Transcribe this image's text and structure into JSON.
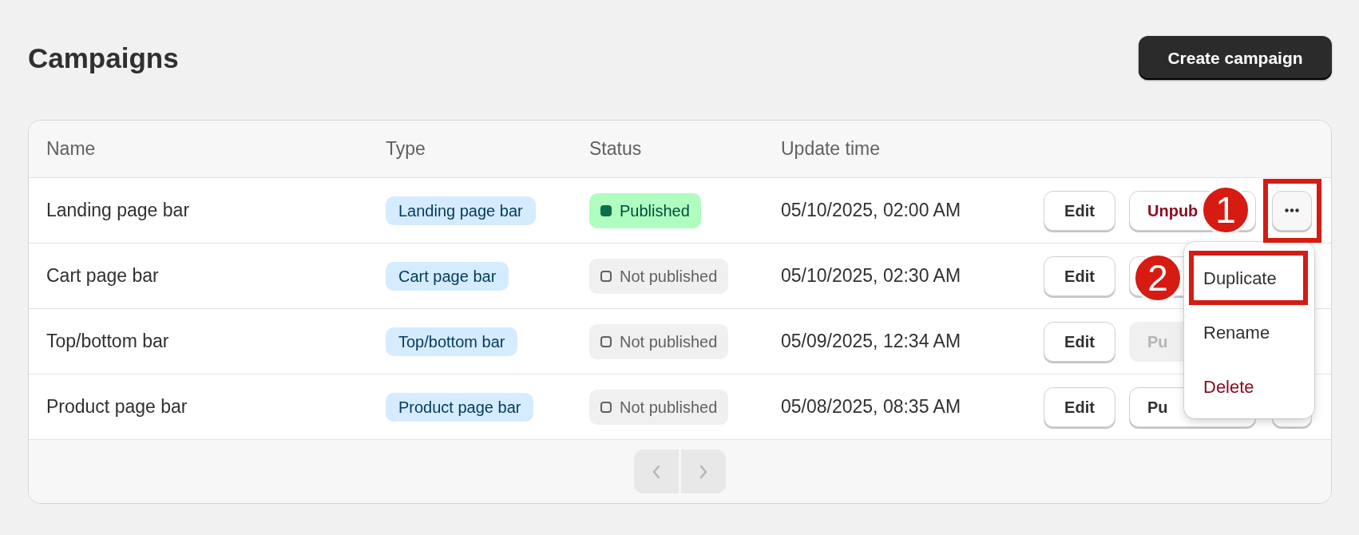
{
  "page": {
    "title": "Campaigns",
    "primary_action": "Create campaign"
  },
  "table": {
    "columns": [
      "Name",
      "Type",
      "Status",
      "Update time"
    ],
    "rows": [
      {
        "name": "Landing page bar",
        "type": "Landing page bar",
        "status": {
          "label": "Published",
          "kind": "published"
        },
        "updated": "05/10/2025, 02:00 AM",
        "edit": "Edit",
        "toggle": {
          "label": "Unpub",
          "kind": "danger",
          "disabled": false
        },
        "more_button": true,
        "menu_open": true
      },
      {
        "name": "Cart page bar",
        "type": "Cart page bar",
        "status": {
          "label": "Not published",
          "kind": "draft"
        },
        "updated": "05/10/2025, 02:30 AM",
        "edit": "Edit",
        "toggle": {
          "kind": "plain",
          "disabled": false
        }
      },
      {
        "name": "Top/bottom bar",
        "type": "Top/bottom bar",
        "status": {
          "label": "Not published",
          "kind": "draft"
        },
        "updated": "05/09/2025, 12:34 AM",
        "edit": "Edit",
        "toggle": {
          "label": "Pu",
          "kind": "plain",
          "disabled": true
        }
      },
      {
        "name": "Product page bar",
        "type": "Product page bar",
        "status": {
          "label": "Not published",
          "kind": "draft"
        },
        "updated": "05/08/2025, 08:35 AM",
        "edit": "Edit",
        "toggle": {
          "label": "Pu",
          "kind": "plain",
          "disabled": false
        },
        "more_button": true
      }
    ],
    "pagination": {
      "previous_disabled": true,
      "next_disabled": true
    }
  },
  "menu": {
    "items": [
      {
        "label": "Duplicate",
        "kind": "normal",
        "highlighted": true
      },
      {
        "label": "Rename",
        "kind": "normal",
        "highlighted": false
      },
      {
        "label": "Delete",
        "kind": "destructive",
        "highlighted": false
      }
    ]
  },
  "annotations": [
    {
      "label": "1"
    },
    {
      "label": "2"
    }
  ]
}
